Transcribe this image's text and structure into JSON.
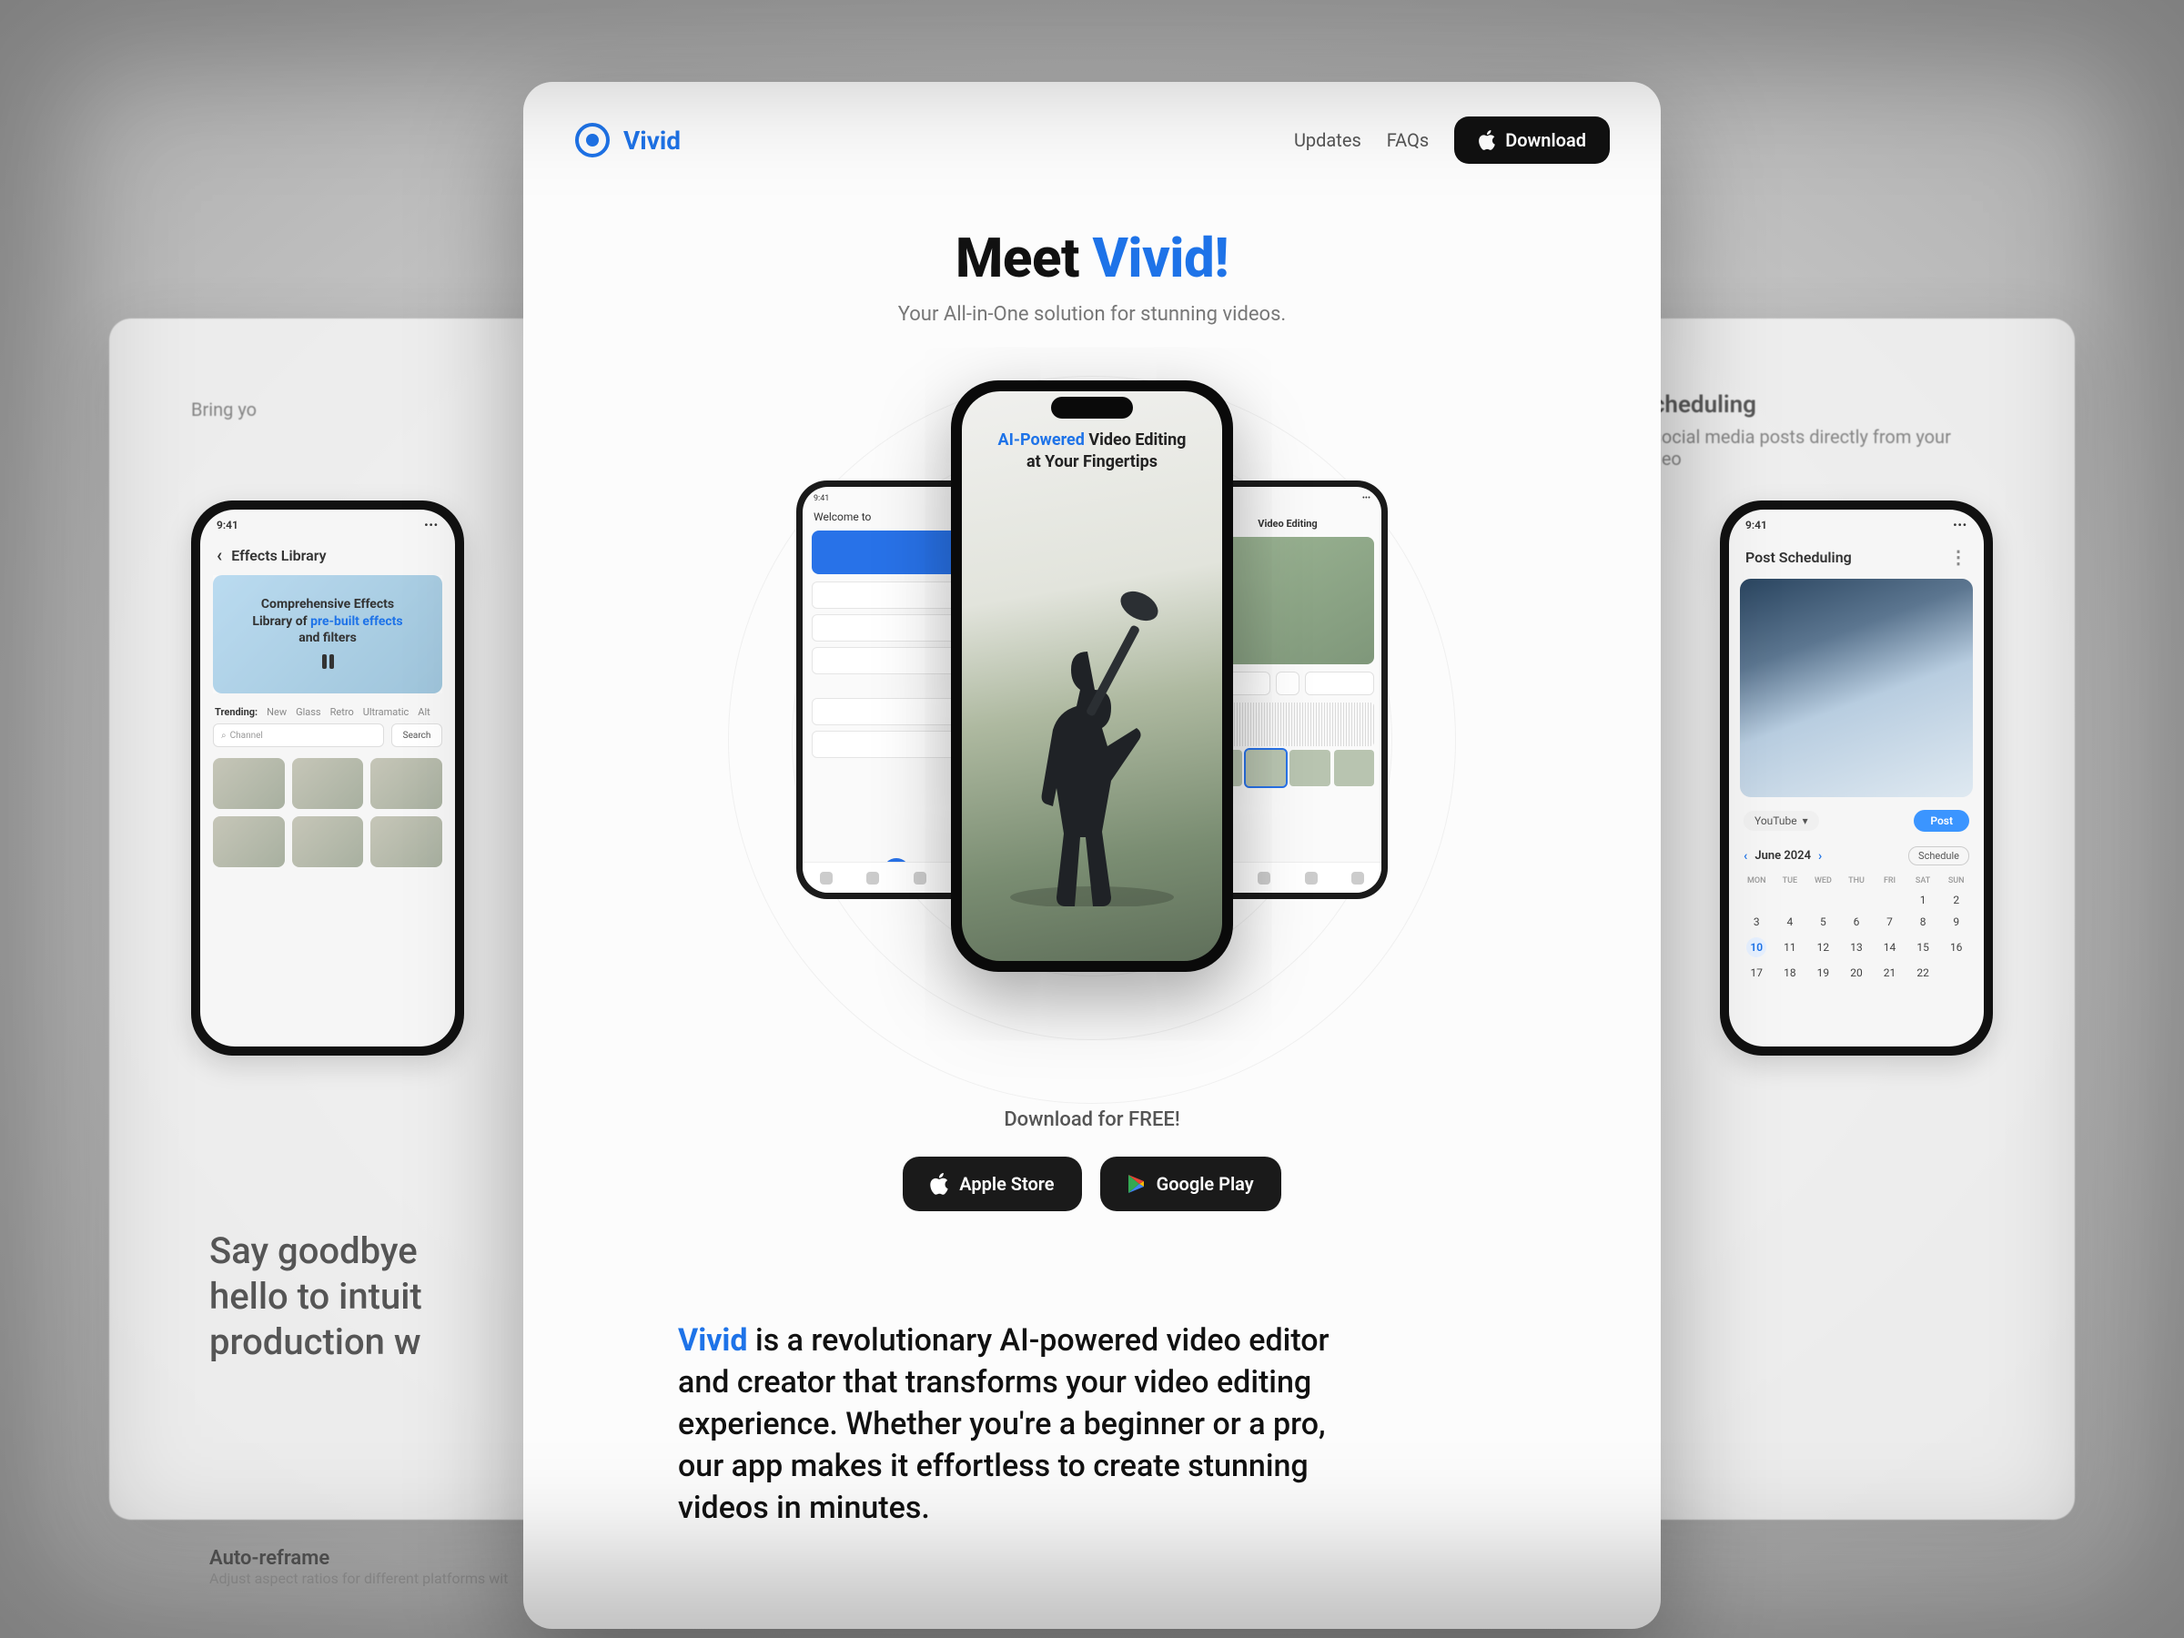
{
  "brand": {
    "name": "Vivid"
  },
  "nav": {
    "updates": "Updates",
    "faqs": "FAQs",
    "download": "Download"
  },
  "hero": {
    "title_prefix": "Meet ",
    "title_accent": "Vivid!",
    "subtitle": "Your All-in-One solution for stunning videos."
  },
  "center_phone": {
    "line1_accent": "AI-Powered",
    "line1_rest": " Video Editing",
    "line2": "at Your Fingertips"
  },
  "back_phone_left": {
    "welcome_prefix": "Welcome to"
  },
  "back_phone_right": {
    "title": "Video Editing"
  },
  "download": {
    "caption": "Download for FREE!",
    "apple": "Apple Store",
    "google": "Google Play"
  },
  "paragraph": {
    "accent": "Vivid",
    "rest": " is a revolutionary AI-powered video editor and creator that transforms your video editing experience. Whether you're a beginner or a pro, our app makes it effortless to create stunning videos in minutes."
  },
  "left_panel": {
    "intro": "Bring yo",
    "phone_title": "Effects Library",
    "phone_time": "9:41",
    "overlay_l1": "Comprehensive Effects",
    "overlay_l2a": "Library of ",
    "overlay_l2b": "pre-built effects",
    "overlay_l3": "and filters",
    "trending": "Trending:",
    "tags": [
      "New",
      "Glass",
      "Retro",
      "Ultramatic",
      "Alt"
    ],
    "search_placeholder": "Channel",
    "search_btn": "Search",
    "lower_h_l1": "Say goodbye",
    "lower_h_l2": "hello to intuit",
    "lower_h_l3": "production w",
    "tiny_title": "Auto-reframe",
    "tiny_sub": "Adjust aspect ratios for different platforms wit"
  },
  "right_panel": {
    "heading": "Scheduling",
    "sub": "e social media posts directly from your video",
    "phone_title": "Post Scheduling",
    "phone_time": "9:41",
    "platform": "YouTube",
    "post": "Post",
    "month": "June 2024",
    "schedule": "Schedule",
    "weekdays": [
      "MON",
      "TUE",
      "WED",
      "THU",
      "FRI",
      "SAT",
      "SUN"
    ],
    "calendar": [
      [
        "",
        "",
        "",
        "",
        "",
        "1",
        "2"
      ],
      [
        "3",
        "4",
        "5",
        "6",
        "7",
        "8",
        "9"
      ],
      [
        "10",
        "11",
        "12",
        "13",
        "14",
        "15",
        "16"
      ],
      [
        "17",
        "18",
        "19",
        "20",
        "21",
        "22",
        ""
      ]
    ],
    "current_day": "10"
  }
}
